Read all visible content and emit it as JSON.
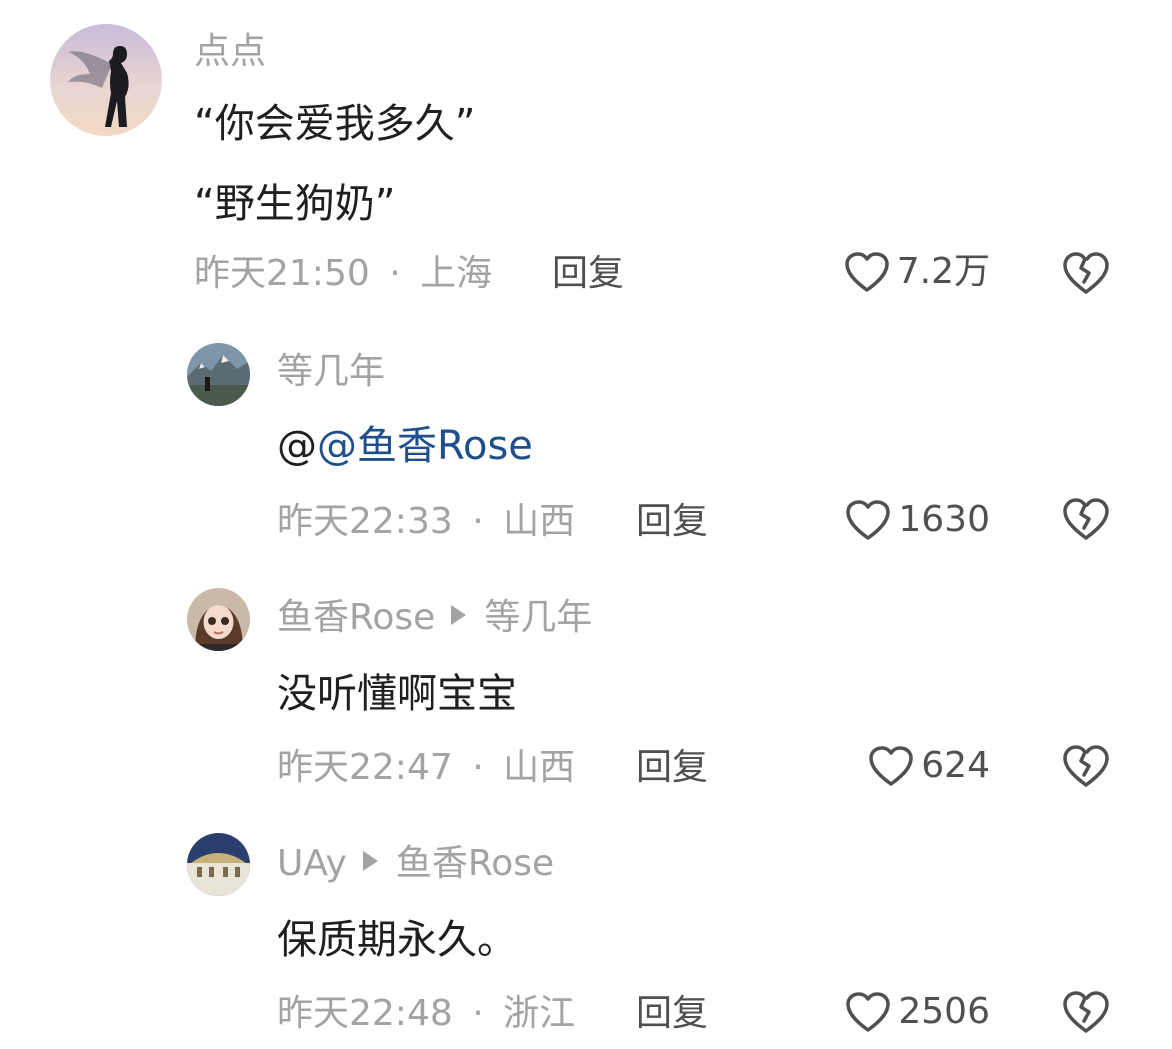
{
  "comments": [
    {
      "avatar_icon": "fairy-silhouette-avatar",
      "username": "点点",
      "lines": [
        "“你会爱我多久”",
        "“野生狗奶”"
      ],
      "time": "昨天21:50",
      "separator": "·",
      "location": "上海",
      "reply_label": "回复",
      "likes": "7.2万"
    },
    {
      "avatar_icon": "mountain-landscape-avatar",
      "username": "等几年",
      "mention_prefix": "@",
      "mention": "@鱼香Rose",
      "time": "昨天22:33",
      "separator": "·",
      "location": "山西",
      "reply_label": "回复",
      "likes": "1630"
    },
    {
      "avatar_icon": "doll-avatar",
      "username": "鱼香Rose",
      "reply_to": "等几年",
      "text": "没听懂啊宝宝",
      "time": "昨天22:47",
      "separator": "·",
      "location": "山西",
      "reply_label": "回复",
      "likes": "624"
    },
    {
      "avatar_icon": "night-building-avatar",
      "username": "UAy",
      "reply_to": "鱼香Rose",
      "text": "保质期永久。",
      "time": "昨天22:48",
      "separator": "·",
      "location": "浙江",
      "reply_label": "回复",
      "likes": "2506"
    }
  ],
  "colors": {
    "muted_text": "#a3a3a3",
    "body_text": "#1f1f1f",
    "mention": "#1e4f8a",
    "icon_stroke": "#505050"
  },
  "icons": {
    "like": "heart-outline-icon",
    "dislike": "broken-heart-icon"
  }
}
